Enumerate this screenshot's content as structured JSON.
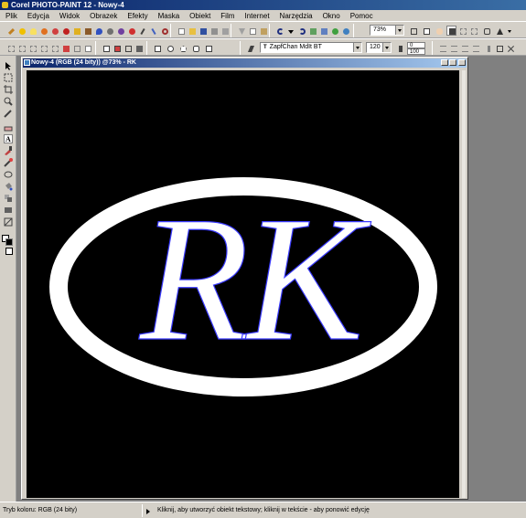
{
  "window": {
    "title": "Corel PHOTO-PAINT 12 - Nowy-4"
  },
  "menu": [
    "Plik",
    "Edycja",
    "Widok",
    "Obrazek",
    "Efekty",
    "Maska",
    "Obiekt",
    "Film",
    "Internet",
    "Narzędzia",
    "Okno",
    "Pomoc"
  ],
  "toolbar": {
    "zoom_value": "73%",
    "font_name": "ZapfChan MdIt BT",
    "font_size": "120",
    "spin_top_value": "0",
    "spin_bottom_value": "100"
  },
  "document": {
    "title": "Nowy-4 (RGB (24 bity)) @73% - RK",
    "monogram_text": "RK",
    "colors": {
      "background": "#000000",
      "ring": "#ffffff",
      "text_outline": "#3a3aff"
    }
  },
  "status": {
    "color_mode": "Tryb koloru: RGB (24 bity)",
    "hint": "Kliknij, aby utworzyć obiekt tekstowy; kliknij w tekście - aby ponowić edycję"
  }
}
